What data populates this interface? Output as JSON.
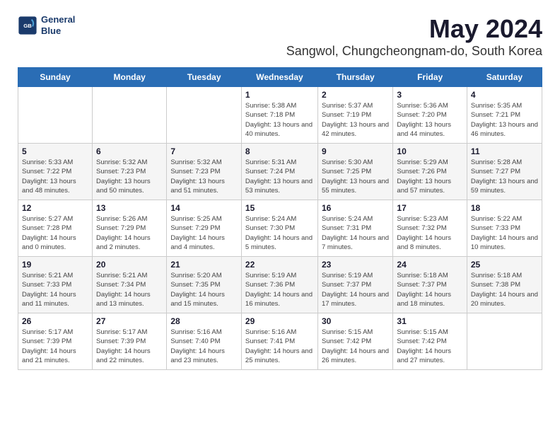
{
  "header": {
    "logo_line1": "General",
    "logo_line2": "Blue",
    "title": "May 2024",
    "subtitle": "Sangwol, Chungcheongnam-do, South Korea"
  },
  "days_of_week": [
    "Sunday",
    "Monday",
    "Tuesday",
    "Wednesday",
    "Thursday",
    "Friday",
    "Saturday"
  ],
  "weeks": [
    [
      {
        "day": "",
        "sunrise": "",
        "sunset": "",
        "daylight": ""
      },
      {
        "day": "",
        "sunrise": "",
        "sunset": "",
        "daylight": ""
      },
      {
        "day": "",
        "sunrise": "",
        "sunset": "",
        "daylight": ""
      },
      {
        "day": "1",
        "sunrise": "Sunrise: 5:38 AM",
        "sunset": "Sunset: 7:18 PM",
        "daylight": "Daylight: 13 hours and 40 minutes."
      },
      {
        "day": "2",
        "sunrise": "Sunrise: 5:37 AM",
        "sunset": "Sunset: 7:19 PM",
        "daylight": "Daylight: 13 hours and 42 minutes."
      },
      {
        "day": "3",
        "sunrise": "Sunrise: 5:36 AM",
        "sunset": "Sunset: 7:20 PM",
        "daylight": "Daylight: 13 hours and 44 minutes."
      },
      {
        "day": "4",
        "sunrise": "Sunrise: 5:35 AM",
        "sunset": "Sunset: 7:21 PM",
        "daylight": "Daylight: 13 hours and 46 minutes."
      }
    ],
    [
      {
        "day": "5",
        "sunrise": "Sunrise: 5:33 AM",
        "sunset": "Sunset: 7:22 PM",
        "daylight": "Daylight: 13 hours and 48 minutes."
      },
      {
        "day": "6",
        "sunrise": "Sunrise: 5:32 AM",
        "sunset": "Sunset: 7:23 PM",
        "daylight": "Daylight: 13 hours and 50 minutes."
      },
      {
        "day": "7",
        "sunrise": "Sunrise: 5:32 AM",
        "sunset": "Sunset: 7:23 PM",
        "daylight": "Daylight: 13 hours and 51 minutes."
      },
      {
        "day": "8",
        "sunrise": "Sunrise: 5:31 AM",
        "sunset": "Sunset: 7:24 PM",
        "daylight": "Daylight: 13 hours and 53 minutes."
      },
      {
        "day": "9",
        "sunrise": "Sunrise: 5:30 AM",
        "sunset": "Sunset: 7:25 PM",
        "daylight": "Daylight: 13 hours and 55 minutes."
      },
      {
        "day": "10",
        "sunrise": "Sunrise: 5:29 AM",
        "sunset": "Sunset: 7:26 PM",
        "daylight": "Daylight: 13 hours and 57 minutes."
      },
      {
        "day": "11",
        "sunrise": "Sunrise: 5:28 AM",
        "sunset": "Sunset: 7:27 PM",
        "daylight": "Daylight: 13 hours and 59 minutes."
      }
    ],
    [
      {
        "day": "12",
        "sunrise": "Sunrise: 5:27 AM",
        "sunset": "Sunset: 7:28 PM",
        "daylight": "Daylight: 14 hours and 0 minutes."
      },
      {
        "day": "13",
        "sunrise": "Sunrise: 5:26 AM",
        "sunset": "Sunset: 7:29 PM",
        "daylight": "Daylight: 14 hours and 2 minutes."
      },
      {
        "day": "14",
        "sunrise": "Sunrise: 5:25 AM",
        "sunset": "Sunset: 7:29 PM",
        "daylight": "Daylight: 14 hours and 4 minutes."
      },
      {
        "day": "15",
        "sunrise": "Sunrise: 5:24 AM",
        "sunset": "Sunset: 7:30 PM",
        "daylight": "Daylight: 14 hours and 5 minutes."
      },
      {
        "day": "16",
        "sunrise": "Sunrise: 5:24 AM",
        "sunset": "Sunset: 7:31 PM",
        "daylight": "Daylight: 14 hours and 7 minutes."
      },
      {
        "day": "17",
        "sunrise": "Sunrise: 5:23 AM",
        "sunset": "Sunset: 7:32 PM",
        "daylight": "Daylight: 14 hours and 8 minutes."
      },
      {
        "day": "18",
        "sunrise": "Sunrise: 5:22 AM",
        "sunset": "Sunset: 7:33 PM",
        "daylight": "Daylight: 14 hours and 10 minutes."
      }
    ],
    [
      {
        "day": "19",
        "sunrise": "Sunrise: 5:21 AM",
        "sunset": "Sunset: 7:33 PM",
        "daylight": "Daylight: 14 hours and 11 minutes."
      },
      {
        "day": "20",
        "sunrise": "Sunrise: 5:21 AM",
        "sunset": "Sunset: 7:34 PM",
        "daylight": "Daylight: 14 hours and 13 minutes."
      },
      {
        "day": "21",
        "sunrise": "Sunrise: 5:20 AM",
        "sunset": "Sunset: 7:35 PM",
        "daylight": "Daylight: 14 hours and 15 minutes."
      },
      {
        "day": "22",
        "sunrise": "Sunrise: 5:19 AM",
        "sunset": "Sunset: 7:36 PM",
        "daylight": "Daylight: 14 hours and 16 minutes."
      },
      {
        "day": "23",
        "sunrise": "Sunrise: 5:19 AM",
        "sunset": "Sunset: 7:37 PM",
        "daylight": "Daylight: 14 hours and 17 minutes."
      },
      {
        "day": "24",
        "sunrise": "Sunrise: 5:18 AM",
        "sunset": "Sunset: 7:37 PM",
        "daylight": "Daylight: 14 hours and 18 minutes."
      },
      {
        "day": "25",
        "sunrise": "Sunrise: 5:18 AM",
        "sunset": "Sunset: 7:38 PM",
        "daylight": "Daylight: 14 hours and 20 minutes."
      }
    ],
    [
      {
        "day": "26",
        "sunrise": "Sunrise: 5:17 AM",
        "sunset": "Sunset: 7:39 PM",
        "daylight": "Daylight: 14 hours and 21 minutes."
      },
      {
        "day": "27",
        "sunrise": "Sunrise: 5:17 AM",
        "sunset": "Sunset: 7:39 PM",
        "daylight": "Daylight: 14 hours and 22 minutes."
      },
      {
        "day": "28",
        "sunrise": "Sunrise: 5:16 AM",
        "sunset": "Sunset: 7:40 PM",
        "daylight": "Daylight: 14 hours and 23 minutes."
      },
      {
        "day": "29",
        "sunrise": "Sunrise: 5:16 AM",
        "sunset": "Sunset: 7:41 PM",
        "daylight": "Daylight: 14 hours and 25 minutes."
      },
      {
        "day": "30",
        "sunrise": "Sunrise: 5:15 AM",
        "sunset": "Sunset: 7:42 PM",
        "daylight": "Daylight: 14 hours and 26 minutes."
      },
      {
        "day": "31",
        "sunrise": "Sunrise: 5:15 AM",
        "sunset": "Sunset: 7:42 PM",
        "daylight": "Daylight: 14 hours and 27 minutes."
      },
      {
        "day": "",
        "sunrise": "",
        "sunset": "",
        "daylight": ""
      }
    ]
  ]
}
